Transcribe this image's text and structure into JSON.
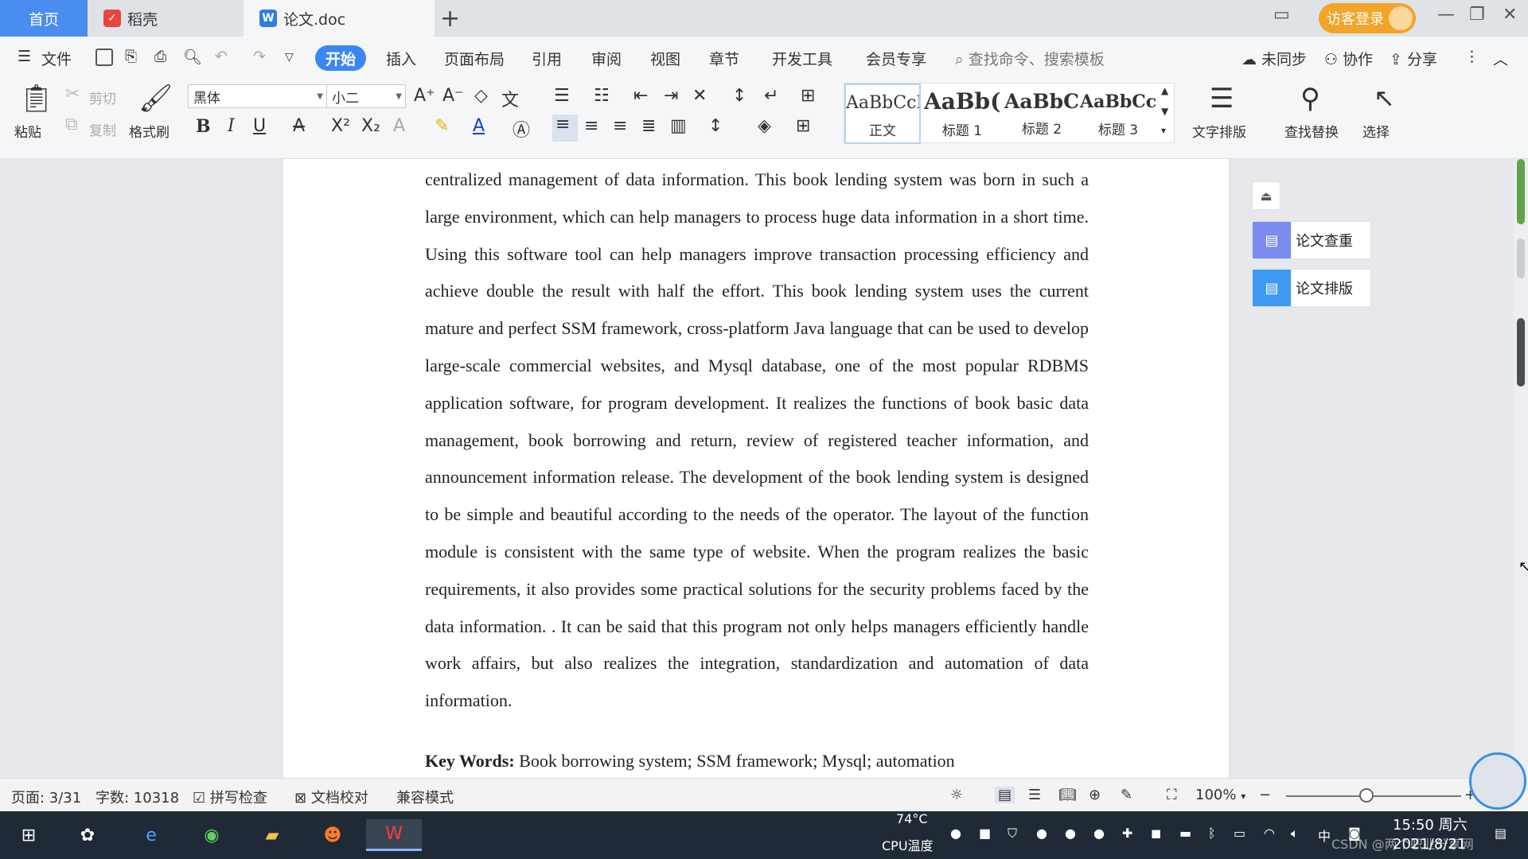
{
  "tabbar": {
    "home_label": "首页",
    "tabs": [
      {
        "label": "稻壳",
        "icon": "daoke-logo-icon"
      },
      {
        "label": "论文.doc",
        "icon": "wps-writer-icon"
      }
    ],
    "new_tab": "+",
    "login_label": "访客登录"
  },
  "menu": {
    "file_label": "文件",
    "items": [
      "开始",
      "插入",
      "页面布局",
      "引用",
      "审阅",
      "视图",
      "章节",
      "开发工具",
      "会员专享"
    ],
    "active": "开始",
    "search_placeholder": "查找命令、搜索模板",
    "sync_label": "未同步",
    "collab_label": "协作",
    "share_label": "分享"
  },
  "ribbon": {
    "paste": "粘贴",
    "cut": "剪切",
    "copy": "复制",
    "format_painter": "格式刷",
    "font_name": "黑体",
    "font_size": "小二",
    "styles": [
      {
        "sample": "AaBbCcI",
        "name": "正文"
      },
      {
        "sample": "AaBb(",
        "name": "标题 1"
      },
      {
        "sample": "AaBbC",
        "name": "标题 2"
      },
      {
        "sample": "AaBbCcl",
        "name": "标题 3"
      }
    ],
    "text_layout": "文字排版",
    "find_replace": "查找替换",
    "select": "选择"
  },
  "document": {
    "paragraph": "centralized management of data information. This book lending system was born in such a large environment, which can help managers to process huge data information in a short time. Using this software tool can help managers improve transaction processing efficiency and achieve double the result with half the effort. This book lending system uses the current mature and perfect SSM framework, cross-platform Java language that can be used to develop large-scale commercial websites, and Mysql database, one of the most popular RDBMS application software, for program development. It realizes the functions of book basic data management, book borrowing and return, review of registered teacher information, and announcement information release. The development of the book lending system is designed to be simple and beautiful according to the needs of the operator. The layout of the function module is consistent with the same type of website. When the program realizes the basic requirements, it also provides some practical solutions for the security problems faced by the data information. . It can be said that this program not only helps managers efficiently handle work affairs, but also realizes the integration, standardization and automation of data information.",
    "keywords_label": "Key Words:",
    "keywords_value": " Book borrowing system; SSM framework; Mysql; automation"
  },
  "side_panel": {
    "check_label": "论文查重",
    "layout_label": "论文排版"
  },
  "statusbar": {
    "page": "页面: 3/31",
    "wordcount": "字数: 10318",
    "spellcheck": "拼写检查",
    "proofread": "文档校对",
    "compat": "兼容模式",
    "zoom": "100%"
  },
  "taskbar": {
    "temp": "74°C",
    "cpu_label": "CPU温度",
    "ime": "中",
    "time": "15:50 周六",
    "date": "2021/8/21",
    "watermark": "CSDN @两个职业分享网"
  }
}
